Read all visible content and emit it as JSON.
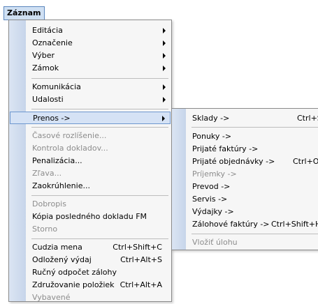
{
  "menubar": {
    "title": "Záznam"
  },
  "main_menu": {
    "items": [
      {
        "label": "Editácia",
        "submenu": true
      },
      {
        "label": "Označenie",
        "submenu": true
      },
      {
        "label": "Výber",
        "submenu": true
      },
      {
        "label": "Zámok",
        "submenu": true
      },
      {
        "label": "Komunikácia",
        "submenu": true
      },
      {
        "label": "Udalosti",
        "submenu": true
      },
      {
        "label": "Prenos ->",
        "submenu": true,
        "highlighted": true
      },
      {
        "label": "Časové rozlíšenie...",
        "disabled": true
      },
      {
        "label": "Kontrola dokladov...",
        "disabled": true
      },
      {
        "label": "Penalizácia..."
      },
      {
        "label": "Zľava...",
        "disabled": true
      },
      {
        "label": "Zaokrúhlenie..."
      },
      {
        "label": "Dobropis",
        "disabled": true
      },
      {
        "label": "Kópia posledného dokladu FM"
      },
      {
        "label": "Storno",
        "disabled": true
      },
      {
        "label": "Cudzia mena",
        "shortcut": "Ctrl+Shift+C"
      },
      {
        "label": "Odložený výdaj",
        "shortcut": "Ctrl+Alt+S"
      },
      {
        "label": "Ručný odpočet zálohy"
      },
      {
        "label": "Združovanie položiek",
        "shortcut": "Ctrl+Alt+A"
      },
      {
        "label": "Vybavené",
        "disabled": true
      }
    ]
  },
  "prenos_submenu": {
    "items": [
      {
        "label": "Sklady ->",
        "shortcut": "Ctrl+S"
      },
      {
        "label": "Ponuky ->"
      },
      {
        "label": "Prijaté faktúry ->"
      },
      {
        "label": "Prijaté objednávky ->",
        "shortcut": "Ctrl+O"
      },
      {
        "label": "Príjemky ->",
        "disabled": true
      },
      {
        "label": "Prevod ->"
      },
      {
        "label": "Servis ->"
      },
      {
        "label": "Výdajky ->"
      },
      {
        "label": "Zálohové faktúry ->",
        "shortcut": "Ctrl+Shift+H"
      },
      {
        "label": "Vložiť úlohu",
        "disabled": true
      }
    ]
  }
}
